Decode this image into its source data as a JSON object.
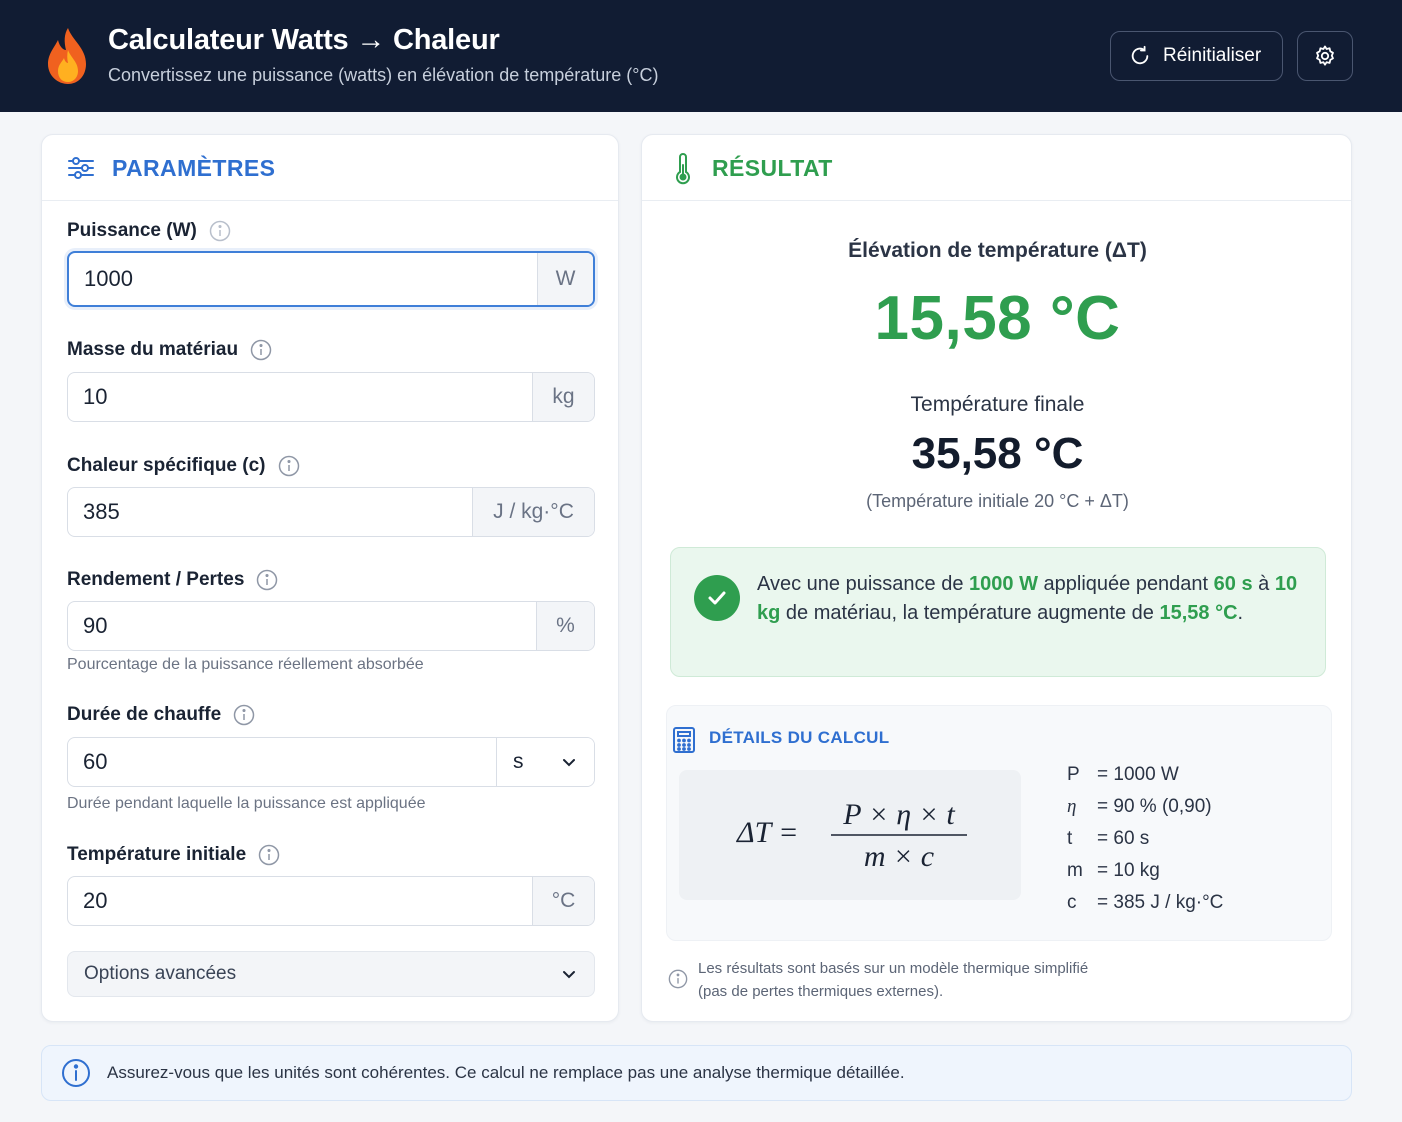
{
  "header": {
    "title": "Calculateur Watts → Chaleur",
    "subtitle": "Convertissez une puissance (watts) en élévation de température (°C)",
    "reset_label": "Réinitialiser",
    "flame_icon": "flame-icon",
    "accent": "#111c33"
  },
  "params": {
    "title": "PARAMÈTRES",
    "power": {
      "label": "Puissance (W)",
      "value": "1000",
      "unit": "W"
    },
    "mass": {
      "label": "Masse du matériau",
      "value": "10",
      "unit": "kg"
    },
    "specific_heat": {
      "label": "Chaleur spécifique (c)",
      "value": "385",
      "unit": "J / kg·°C"
    },
    "efficiency": {
      "label": "Rendement / Pertes",
      "value": "90",
      "unit": "%",
      "hint": "Pourcentage de la puissance réellement absorbée"
    },
    "duration": {
      "label": "Durée de chauffe",
      "value": "60",
      "unit": "s",
      "hint": "Durée pendant laquelle la puissance est appliquée"
    },
    "initial_temp": {
      "label": "Température initiale",
      "value": "20",
      "unit": "°C"
    },
    "advanced_label": "Options avancées"
  },
  "result": {
    "title": "RÉSULTAT",
    "delta_label": "Élévation de température (ΔT)",
    "delta_value": "15,58 °C",
    "final_label": "Température finale",
    "final_value": "35,58 °C",
    "final_note": "(Température initiale 20 °C + ΔT)",
    "summary": {
      "p1": "Avec une puissance de ",
      "power": "1000 W",
      "p2": " appliquée pendant ",
      "duration": "60 s",
      "p3": " à ",
      "mass": "10 kg",
      "p4": " de matériau, la température augmente de ",
      "delta": "15,58 °C",
      "p5": "."
    },
    "success_color": "#2f9e4f"
  },
  "details": {
    "title": "DÉTAILS DU CALCUL",
    "formula": {
      "lhs": "ΔT =",
      "numerator": "P × η × t",
      "denominator": "m × c"
    },
    "vars": [
      {
        "name": "P",
        "value": "= 1000 W"
      },
      {
        "name": "η",
        "value": "= 90 % (0,90)"
      },
      {
        "name": "t",
        "value": "= 60 s"
      },
      {
        "name": "m",
        "value": "= 10 kg"
      },
      {
        "name": "c",
        "value": "= 385 J / kg·°C"
      }
    ],
    "footnote_line1": "Les résultats sont basés sur un modèle thermique simplifié",
    "footnote_line2": "(pas de pertes thermiques externes)."
  },
  "banner": {
    "text": "Assurez-vous que les unités sont cohérentes. Ce calcul ne remplace pas une analyse thermique détaillée."
  }
}
